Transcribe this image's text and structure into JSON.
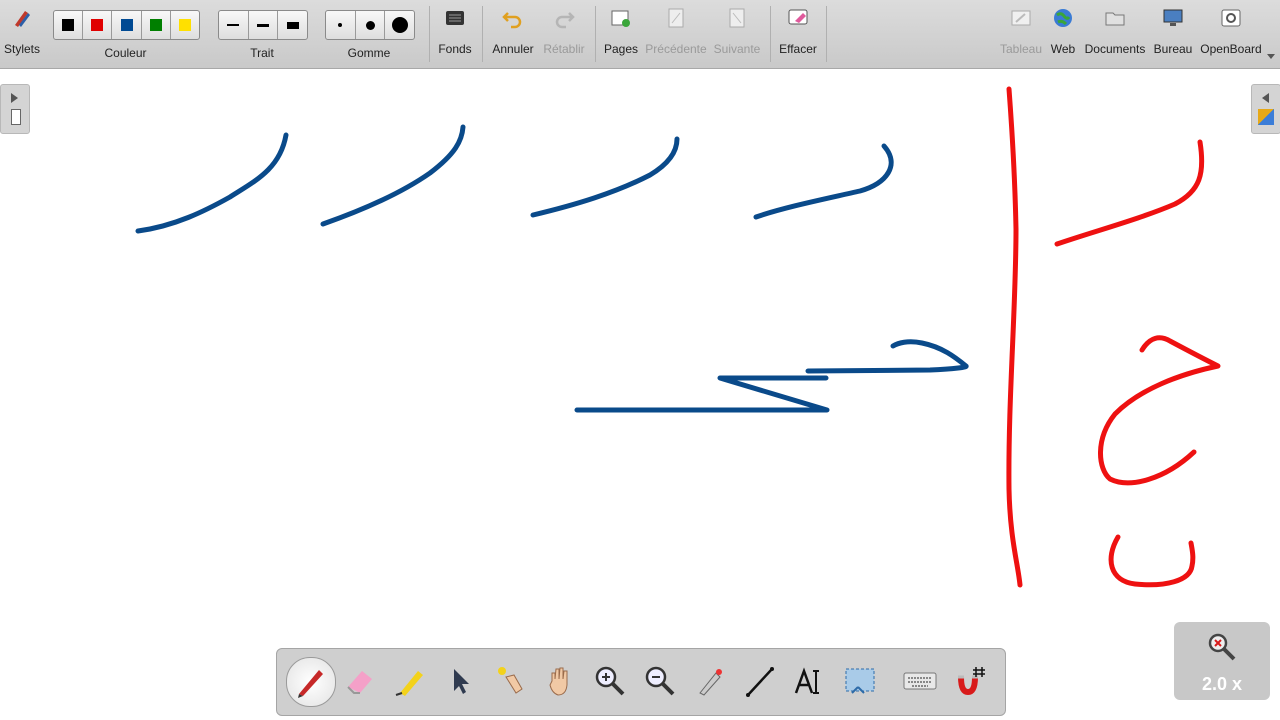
{
  "toolbar": {
    "stylets": "Stylets",
    "couleur": "Couleur",
    "trait": "Trait",
    "gomme": "Gomme",
    "fonds": "Fonds",
    "annuler": "Annuler",
    "retablir": "Rétablir",
    "pages": "Pages",
    "precedente": "Précédente",
    "suivante": "Suivante",
    "effacer": "Effacer",
    "tableau": "Tableau",
    "web": "Web",
    "documents": "Documents",
    "bureau": "Bureau",
    "openboard": "OpenBoard"
  },
  "colors": {
    "swatches": [
      "#000000",
      "#e00000",
      "#004a93",
      "#007f00",
      "#ffe000"
    ],
    "ink_blue": "#0a4a8a",
    "ink_red": "#ee1111"
  },
  "zoom": {
    "level": "2.0 x"
  },
  "dock_icons": [
    "pen-icon",
    "eraser-icon",
    "highlighter-icon",
    "pointer-icon",
    "laser-icon",
    "hand-icon",
    "zoom-in-icon",
    "zoom-out-icon",
    "pipette-icon",
    "line-icon",
    "text-icon",
    "capture-icon",
    "keyboard-icon",
    "magnet-grid-icon"
  ]
}
